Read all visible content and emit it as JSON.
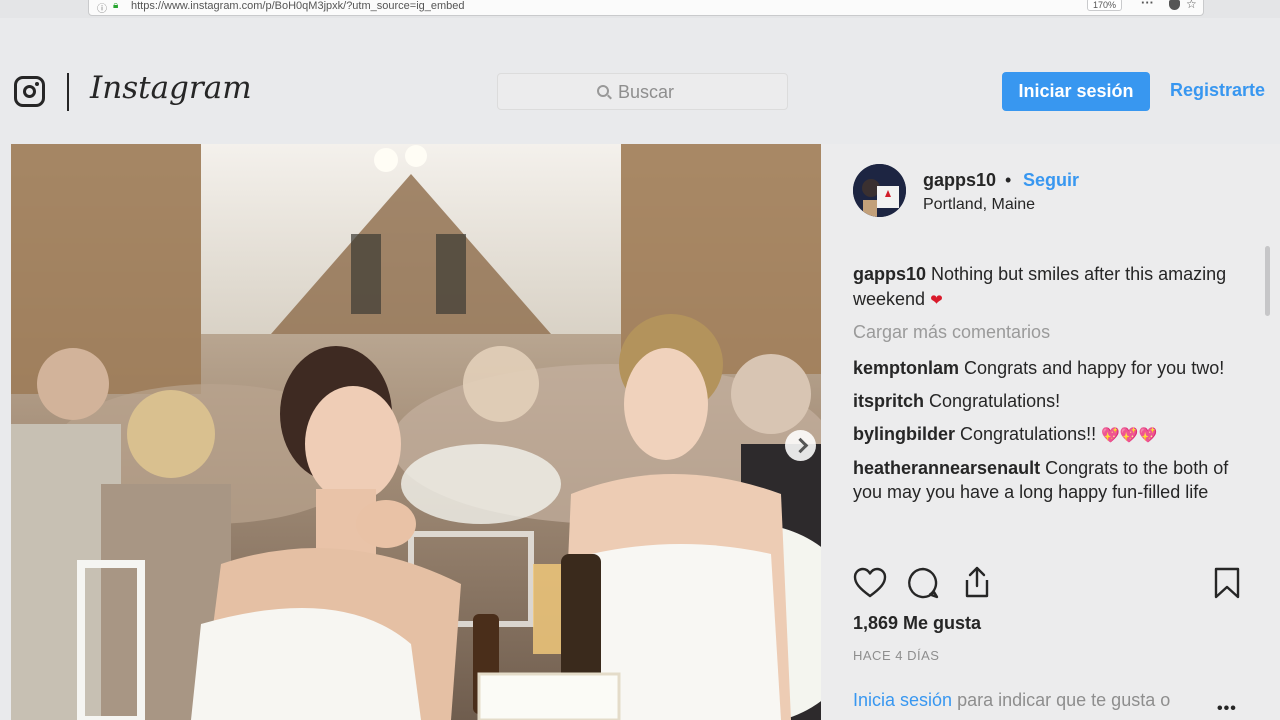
{
  "browser": {
    "url": "https://www.instagram.com/p/BoH0qM3jpxk/?utm_source=ig_embed",
    "zoom": "170%"
  },
  "header": {
    "logo_text": "Instagram",
    "search_placeholder": "Buscar",
    "login_label": "Iniciar sesión",
    "signup_label": "Registrarte"
  },
  "post": {
    "username": "gapps10",
    "separator": "•",
    "follow_label": "Seguir",
    "location": "Portland, Maine",
    "caption_user": "gapps10",
    "caption_text": "Nothing but smiles after this amazing weekend",
    "caption_emoji": "❤",
    "load_more": "Cargar más comentarios",
    "comments": [
      {
        "user": "kemptonlam",
        "text": "Congrats and happy for you two!"
      },
      {
        "user": "itspritch",
        "text": "Congratulations!"
      },
      {
        "user": "bylingbilder",
        "text": "Congratulations!!",
        "emoji": "💖💖💖"
      },
      {
        "user": "heatherannearsenault",
        "text": "Congrats to the both of you may you have a long happy fun-filled life"
      }
    ],
    "likes": "1,869 Me gusta",
    "date": "HACE 4 DÍAS",
    "prompt_link": "Inicia sesión",
    "prompt_text": "para indicar que te gusta o",
    "more_options": "•••"
  },
  "icons": [
    "instagram-camera-icon",
    "search-icon",
    "heart-icon",
    "comment-icon",
    "share-icon",
    "bookmark-icon",
    "chevron-right-icon",
    "lock-icon",
    "star-icon"
  ],
  "colors": {
    "accent": "#3897f0",
    "text": "#262626",
    "muted": "#8e8e8e",
    "background": "#ececed"
  }
}
